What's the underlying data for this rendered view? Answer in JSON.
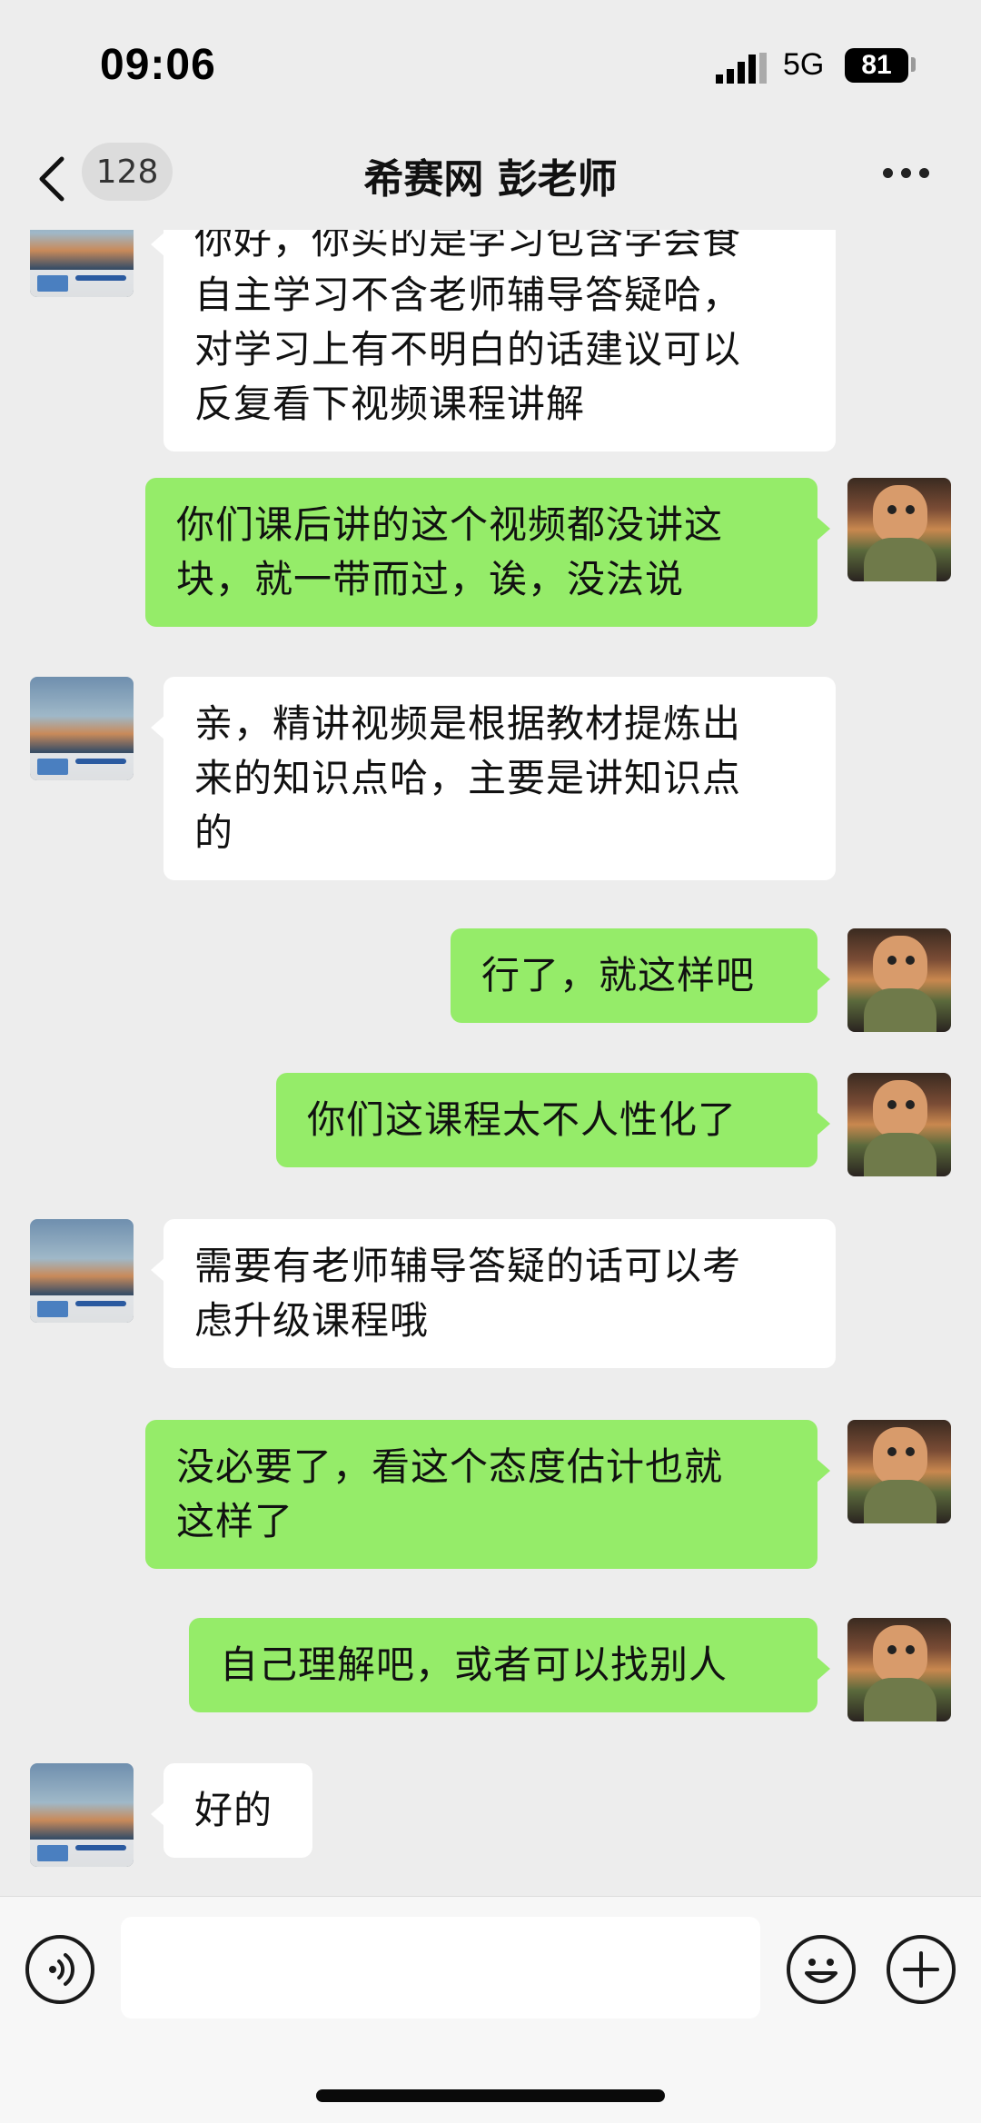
{
  "status_bar": {
    "time": "09:06",
    "network": "5G",
    "battery": "81"
  },
  "nav": {
    "unread_count": "128",
    "title": "希赛网 彭老师"
  },
  "colors": {
    "background": "#ededed",
    "sent_bubble": "#95ec69",
    "received_bubble": "#ffffff"
  },
  "avatars": {
    "teacher_label": "彭老师"
  },
  "messages": [
    {
      "side": "left",
      "lines": [
        "你好，你买的是学习包含学会食",
        "自主学习不含老师辅导答疑哈，",
        "对学习上有不明白的话建议可以",
        "反复看下视频课程讲解"
      ]
    },
    {
      "side": "right",
      "lines": [
        "你们课后讲的这个视频都没讲这",
        "块，就一带而过，诶，没法说"
      ]
    },
    {
      "side": "left",
      "lines": [
        "亲，精讲视频是根据教材提炼出",
        "来的知识点哈，主要是讲知识点",
        "的"
      ]
    },
    {
      "side": "right",
      "lines": [
        "行了，就这样吧"
      ]
    },
    {
      "side": "right",
      "lines": [
        "你们这课程太不人性化了"
      ]
    },
    {
      "side": "left",
      "lines": [
        "需要有老师辅导答疑的话可以考",
        "虑升级课程哦"
      ]
    },
    {
      "side": "right",
      "lines": [
        "没必要了，看这个态度估计也就",
        "这样了"
      ]
    },
    {
      "side": "right",
      "lines": [
        "自己理解吧，或者可以找别人"
      ]
    },
    {
      "side": "left",
      "lines": [
        "好的"
      ]
    }
  ],
  "input_bar": {
    "voice_icon": "voice-icon",
    "emoji_icon": "emoji-icon",
    "plus_icon": "plus-icon",
    "text_value": ""
  }
}
